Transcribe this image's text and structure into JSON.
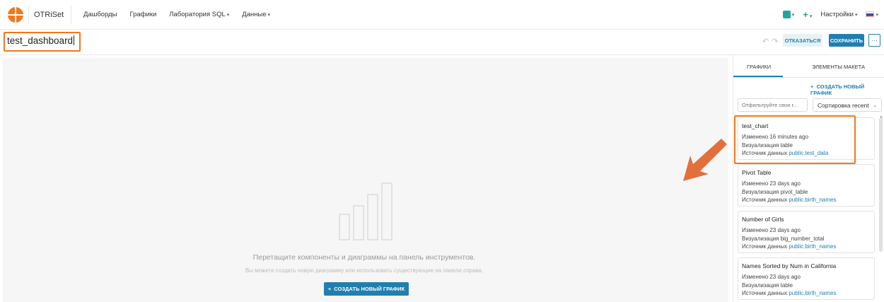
{
  "navbar": {
    "brand": "OTRiSet",
    "menu": [
      {
        "label": "Дашборды",
        "caret": false
      },
      {
        "label": "Графики",
        "caret": false
      },
      {
        "label": "Лаборатория SQL",
        "caret": true
      },
      {
        "label": "Данные",
        "caret": true
      }
    ],
    "settings_label": "Настройки",
    "icons": {
      "logo": "logo-icon",
      "db": "database-icon",
      "plus": "plus-icon",
      "flag": "flag-ru-icon"
    }
  },
  "header": {
    "dashboard_title": "test_dashboard",
    "discard_label": "ОТКАЗАТЬСЯ",
    "save_label": "СОХРАНИТЬ",
    "more_label": "···"
  },
  "canvas": {
    "empty_title": "Перетащите компоненты и диаграммы на панель инструментов.",
    "empty_subtitle": "Вы можете создать новую диаграмму или использовать существующие на панели справа.",
    "create_button_label": "СОЗДАТЬ НОВЫЙ ГРАФИК"
  },
  "panel": {
    "tabs": [
      {
        "label": "ГРАФИКИ",
        "active": true
      },
      {
        "label": "ЭЛЕМЕНТЫ МАКЕТА",
        "active": false
      }
    ],
    "create_link_label": "СОЗДАТЬ НОВЫЙ ГРАФИК",
    "filter_placeholder": "Отфильтруйте свои г...",
    "sort_label": "Сортировка recent",
    "charts": [
      {
        "title": "test_chart",
        "modified": "Изменено 16 minutes ago",
        "viz": "Визуализация table",
        "source_prefix": "Источник данных ",
        "source": "public.test_data"
      },
      {
        "title": "Pivot Table",
        "modified": "Изменено 23 days ago",
        "viz": "Визуализация pivot_table",
        "source_prefix": "Источник данных ",
        "source": "public.birth_names"
      },
      {
        "title": "Number of Girls",
        "modified": "Изменено 23 days ago",
        "viz": "Визуализация big_number_total",
        "source_prefix": "Источник данных ",
        "source": "public.birth_names"
      },
      {
        "title": "Names Sorted by Num in California",
        "modified": "Изменено 23 days ago",
        "viz": "Визуализация table",
        "source_prefix": "Источник данных ",
        "source": "public.birth_names"
      }
    ]
  },
  "colors": {
    "accent": "#1f7fb0",
    "highlight": "#f2771f",
    "teal": "#1ea7a0",
    "arrow": "#e2703a"
  }
}
